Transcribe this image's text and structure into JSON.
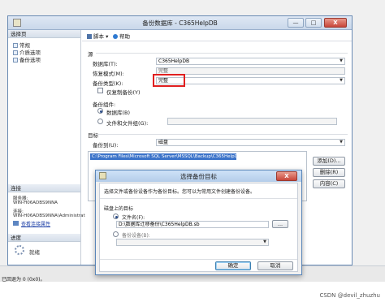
{
  "main_window": {
    "title": "备份数据库 - C365HelpDB",
    "buttons": {
      "min": "—",
      "max": "□",
      "close": "X"
    }
  },
  "left_pane": {
    "select_page_header": "选择页",
    "pages": [
      {
        "label": "常规",
        "icon": "page-icon"
      },
      {
        "label": "介质选项",
        "icon": "page-icon"
      },
      {
        "label": "备份选项",
        "icon": "page-icon"
      }
    ],
    "connection_header": "连接",
    "server_label": "服务器:",
    "server_value": "WIN-H06ADBS9NNA",
    "connection_label": "连接:",
    "connection_value": "WIN-H06ADBS9NNA\\Administrat",
    "view_connection_link": "查看连接属性",
    "progress_header": "进度",
    "progress_status": "就绪"
  },
  "toolbar": {
    "script_label": "脚本",
    "help_label": "帮助"
  },
  "source": {
    "section_label": "源",
    "database_label": "数据库(T):",
    "database_value": "C365HelpDB",
    "recovery_label": "恢复模式(M):",
    "recovery_value": "完整",
    "backup_type_label": "备份类型(K):",
    "backup_type_value": "完整",
    "copy_only_label": "仅复制备份(Y)",
    "component_label": "备份组件:",
    "database_radio_label": "数据库(B)",
    "files_radio_label": "文件和文件组(G):"
  },
  "destination": {
    "section_label": "目标",
    "backup_to_label": "备份到(U):",
    "backup_to_value": "磁盘",
    "path_value": "C:\\Program Files\\Microsoft SQL Server\\MSSQL\\Backup\\C365HelpDB.bak",
    "add_button": "添加(D)...",
    "remove_button": "删除(R)",
    "contents_button": "内容(C)"
  },
  "dialog": {
    "title": "选择备份目标",
    "description": "选择文件或备份设备作为备份目标。您可以为常用文件创建备份设备。",
    "disk_target_label": "磁盘上的目标",
    "filename_radio_label": "文件名(F):",
    "filename_value": "D:\\数据库迁移备份\\C365HelpDB.sb",
    "browse_button": "...",
    "device_radio_label": "备份设备(B):",
    "ok_button": "确定",
    "cancel_button": "取消",
    "close_button": "X"
  },
  "statusbar": {
    "text": "已回退为 0 (0x0)。"
  },
  "watermark": "CSDN @devil_zhuzhu",
  "colors": {
    "highlight_box": "#e02020",
    "selection": "#3b73c9",
    "link": "#1c3fa6"
  }
}
